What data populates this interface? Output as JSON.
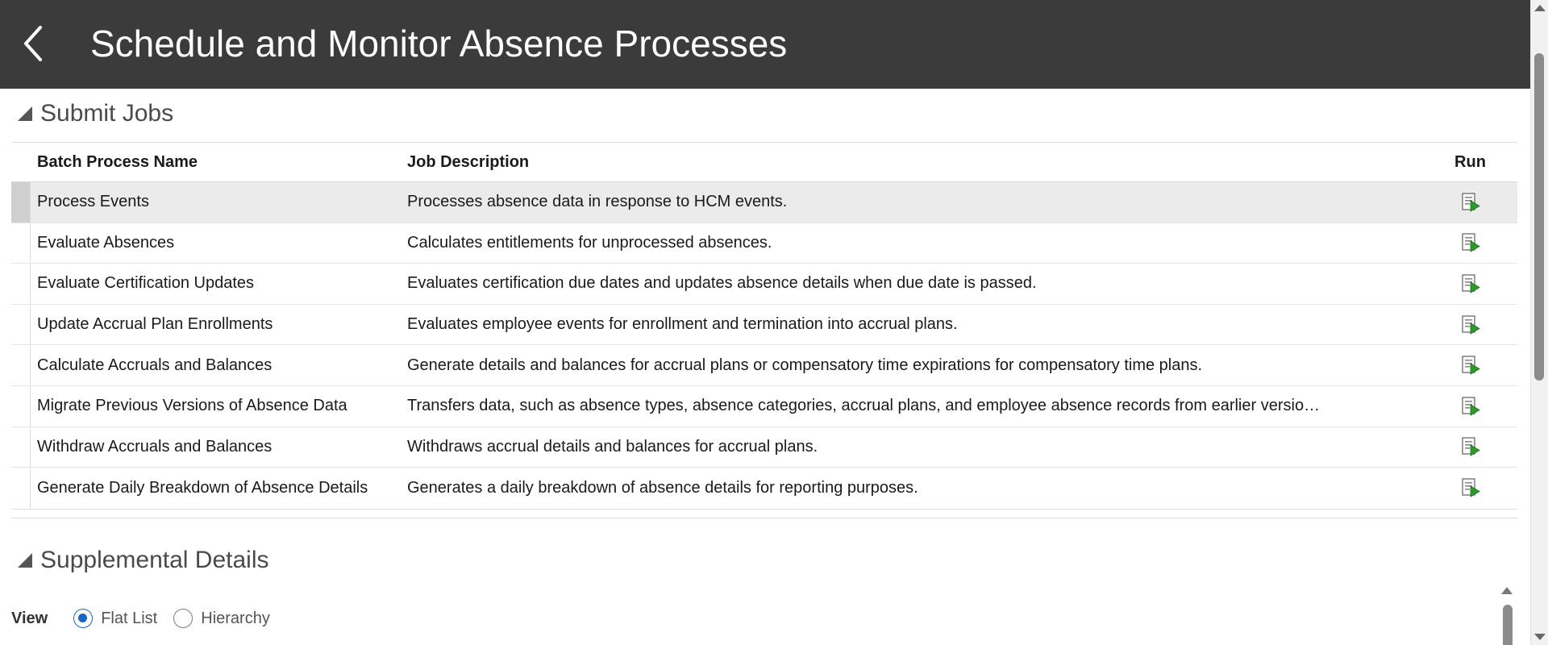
{
  "header": {
    "title": "Schedule and Monitor Absence Processes",
    "back_icon": "chevron-left-icon"
  },
  "submit_jobs": {
    "title": "Submit Jobs",
    "columns": {
      "name": "Batch Process Name",
      "description": "Job Description",
      "run": "Run"
    },
    "rows": [
      {
        "name": "Process Events",
        "description": "Processes absence data in response to HCM events."
      },
      {
        "name": "Evaluate Absences",
        "description": "Calculates entitlements for unprocessed absences."
      },
      {
        "name": "Evaluate Certification Updates",
        "description": "Evaluates certification due dates and updates absence details when due date is passed."
      },
      {
        "name": "Update Accrual Plan Enrollments",
        "description": "Evaluates employee events for enrollment and termination into accrual plans."
      },
      {
        "name": "Calculate Accruals and Balances",
        "description": "Generate details and balances for accrual plans or compensatory time expirations for compensatory time plans."
      },
      {
        "name": "Migrate Previous Versions of Absence Data",
        "description": "Transfers data, such as absence types, absence categories, accrual plans, and employee absence records from earlier versio…"
      },
      {
        "name": "Withdraw Accruals and Balances",
        "description": "Withdraws accrual details and balances for accrual plans."
      },
      {
        "name": "Generate Daily Breakdown of Absence Details",
        "description": "Generates a daily breakdown of absence details for reporting purposes."
      }
    ],
    "selected_row": 0,
    "run_icon": "run-job-icon"
  },
  "supplemental": {
    "title": "Supplemental Details",
    "view_label": "View",
    "options": [
      {
        "label": "Flat List",
        "checked": true
      },
      {
        "label": "Hierarchy",
        "checked": false
      }
    ]
  },
  "colors": {
    "header_bg": "#3b3b3b",
    "accent": "#1668c7",
    "run_green": "#2e9a2e"
  }
}
